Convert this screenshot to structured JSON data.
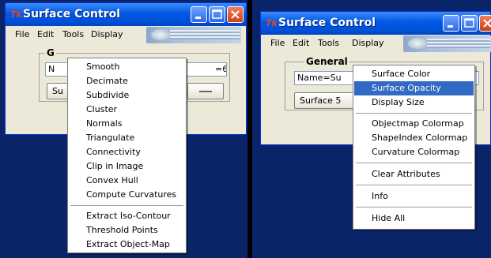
{
  "left_window": {
    "title": "Surface Control",
    "menus": [
      "File",
      "Edit",
      "Tools",
      "Display"
    ],
    "partial": {
      "group_title_fragment": "G",
      "name_fragment": "N",
      "button_fragment": "Su",
      "field_suffix": "=6"
    },
    "tools_menu": {
      "items": [
        "Smooth",
        "Decimate",
        "Subdivide",
        "Cluster",
        "Normals",
        "Triangulate",
        "Connectivity",
        "Clip in Image",
        "Convex Hull",
        "Compute Curvatures",
        "Extract Iso-Contour",
        "Threshold Points",
        "Extract Object-Map"
      ]
    }
  },
  "right_window": {
    "title": "Surface Control",
    "menus": [
      "File",
      "Edit",
      "Tools",
      "Display"
    ],
    "partial": {
      "group_title": "General",
      "name_field": "Name=Su",
      "surface_button": "Surface 5"
    },
    "display_menu": {
      "items": [
        "Surface Color",
        "Surface Opacity",
        "Display Size",
        "Objectmap Colormap",
        "ShapeIndex Colormap",
        "Curvature  Colormap",
        "Clear Attributes",
        "Info",
        "Hide All"
      ],
      "selected": "Surface Opacity"
    }
  },
  "icons": {
    "app": "tk-feather-icon",
    "minimize": "minimize-icon",
    "maximize": "maximize-icon",
    "close": "close-icon"
  },
  "colors": {
    "titlebar": "#0058e6",
    "menu_highlight": "#316ac5",
    "desktop": "#0a246a",
    "window_bg": "#ece9d8"
  }
}
